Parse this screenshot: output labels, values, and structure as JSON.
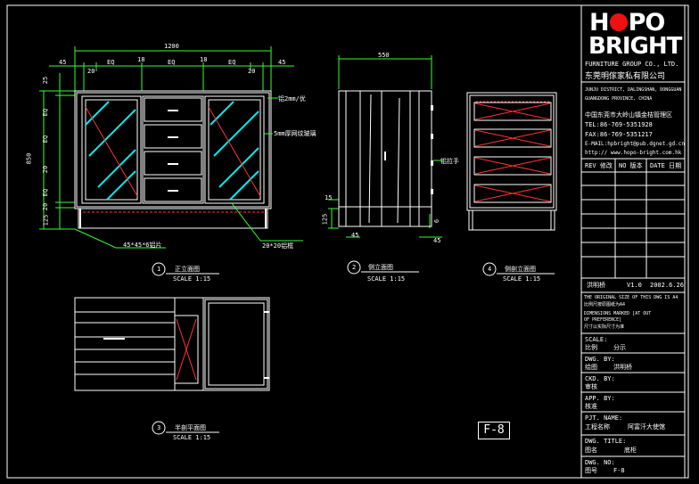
{
  "title_block": {
    "logo_top": "H",
    "logo_top_rest": "PO",
    "logo_bottom": "BRIGHT",
    "company_en": "FURNITURE GROUP CO., LTD.",
    "company_cn": "东莞明傢家私有限公司",
    "address": [
      "JUNJU DISTRICT, DALINGSHAN, DONGGUAN",
      "GUANGDONG PROVINCE, CHINA"
    ],
    "address_cn": "中国东莞市大岭山镇金桔管理区",
    "tel": "TEL:86-769-5351928",
    "fax": "FAX:86-769-5351217",
    "email": "E-MAIL:hpbright@pub.dgnet.gd.cn",
    "web": "http:// www.hopo-bright.com.hk",
    "rev_headers": [
      "REV 修改",
      "NO 版本",
      "DATE 日期"
    ],
    "designer": "洪明桥",
    "version": "V1.0",
    "date": "2002.6.26",
    "note_lines": [
      "THE ORIGINAL SIZE OF THIS DWG IS A4",
      "比例尺按原图纸为A4",
      "DIMENSIONS MARKED [AT OUT",
      "OF PREFERENCE]",
      "尺寸以实际尺寸为准"
    ],
    "fields": [
      {
        "label": "SCALE:",
        "label_cn": "比例",
        "value": "分示"
      },
      {
        "label": "DWG. BY:",
        "label_cn": "绘图",
        "value": "洪明桥"
      },
      {
        "label": "CKD. BY:",
        "label_cn": "审核",
        "value": ""
      },
      {
        "label": "APP. BY:",
        "label_cn": "核准",
        "value": ""
      },
      {
        "label": "PJT. NAME:",
        "label_cn": "工程名称",
        "value": "阿富汗大使馆"
      },
      {
        "label": "DWG. TITLE:",
        "label_cn": "图名",
        "value": "底柜"
      },
      {
        "label": "DWG. NO:",
        "label_cn": "图号",
        "value": "F-8"
      }
    ]
  },
  "views": [
    {
      "num": "1",
      "title": "正立面图",
      "scale": "SCALE 1:15"
    },
    {
      "num": "2",
      "title": "侧立面图",
      "scale": "SCALE 1:15"
    },
    {
      "num": "3",
      "title": "半剖平面图",
      "scale": "SCALE 1:15"
    },
    {
      "num": "4",
      "title": "侧剖立面图",
      "scale": "SCALE 1:15"
    }
  ],
  "dims": {
    "total_width": "1200",
    "side_left": "45",
    "side_right": "45",
    "inner_20a": "20",
    "inner_20b": "20",
    "eq1": "EQ",
    "eq2": "EQ",
    "eq3": "EQ",
    "gap18a": "18",
    "gap18b": "18",
    "height": "850",
    "v25": "25",
    "veq1": "EQ",
    "veq2": "EQ",
    "veq3": "EQ",
    "v20a": "20",
    "v20b": "20",
    "v125": "125",
    "depth": "550",
    "s15": "15",
    "s125": "125",
    "s45a": "45",
    "s45b": "45",
    "s6": "6"
  },
  "notes": {
    "glass": "5mm厚网纹玻璃",
    "alu": "铝2mm/优",
    "handle": "铝拉手",
    "foot": "45*45*6铝片",
    "frame": "20*20铝框"
  },
  "drawing_no": "F-8",
  "colors": {
    "line": "#ffffff",
    "dim": "#33ff33",
    "accent": "#ff3333",
    "glass": "#00e5ff",
    "bg": "#000000"
  }
}
